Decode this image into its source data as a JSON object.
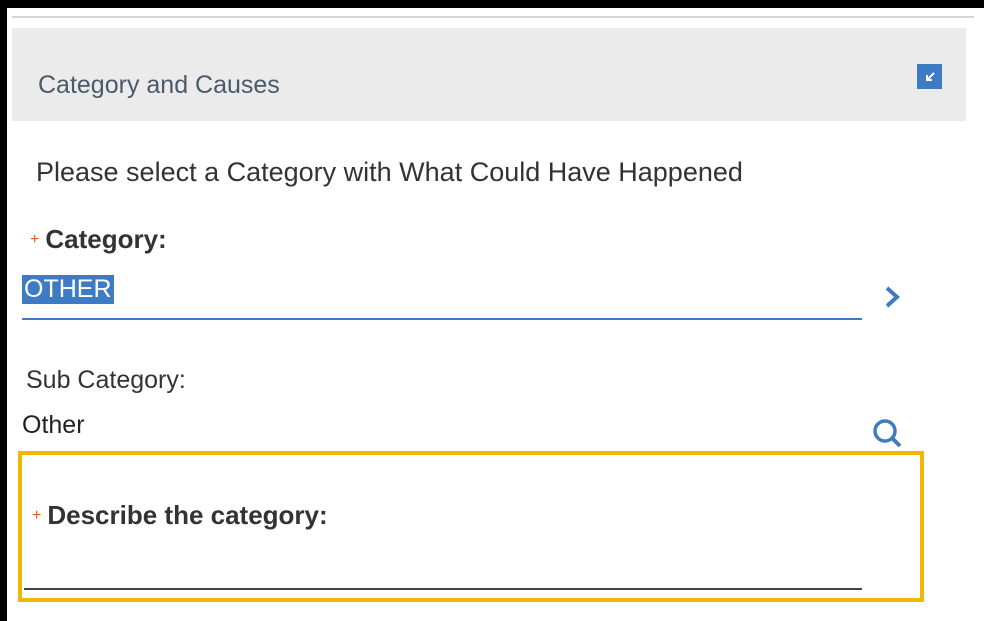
{
  "panel": {
    "title": "Category and Causes",
    "collapse_icon": "collapse-arrow-icon"
  },
  "instructions": "Please select a Category with What Could Have Happened",
  "category": {
    "required_marker": "+",
    "label": "Category:",
    "value": "OTHER",
    "action_icon": "chevron-right-icon"
  },
  "sub_category": {
    "label": "Sub Category:",
    "value": "Other",
    "action_icon": "search-icon"
  },
  "describe": {
    "required_marker": "+",
    "label": "Describe the category:",
    "value": ""
  },
  "colors": {
    "accent": "#3d7bc4",
    "required": "#e55a1f",
    "highlight": "#f2b705",
    "header_bg": "#ebebeb"
  }
}
